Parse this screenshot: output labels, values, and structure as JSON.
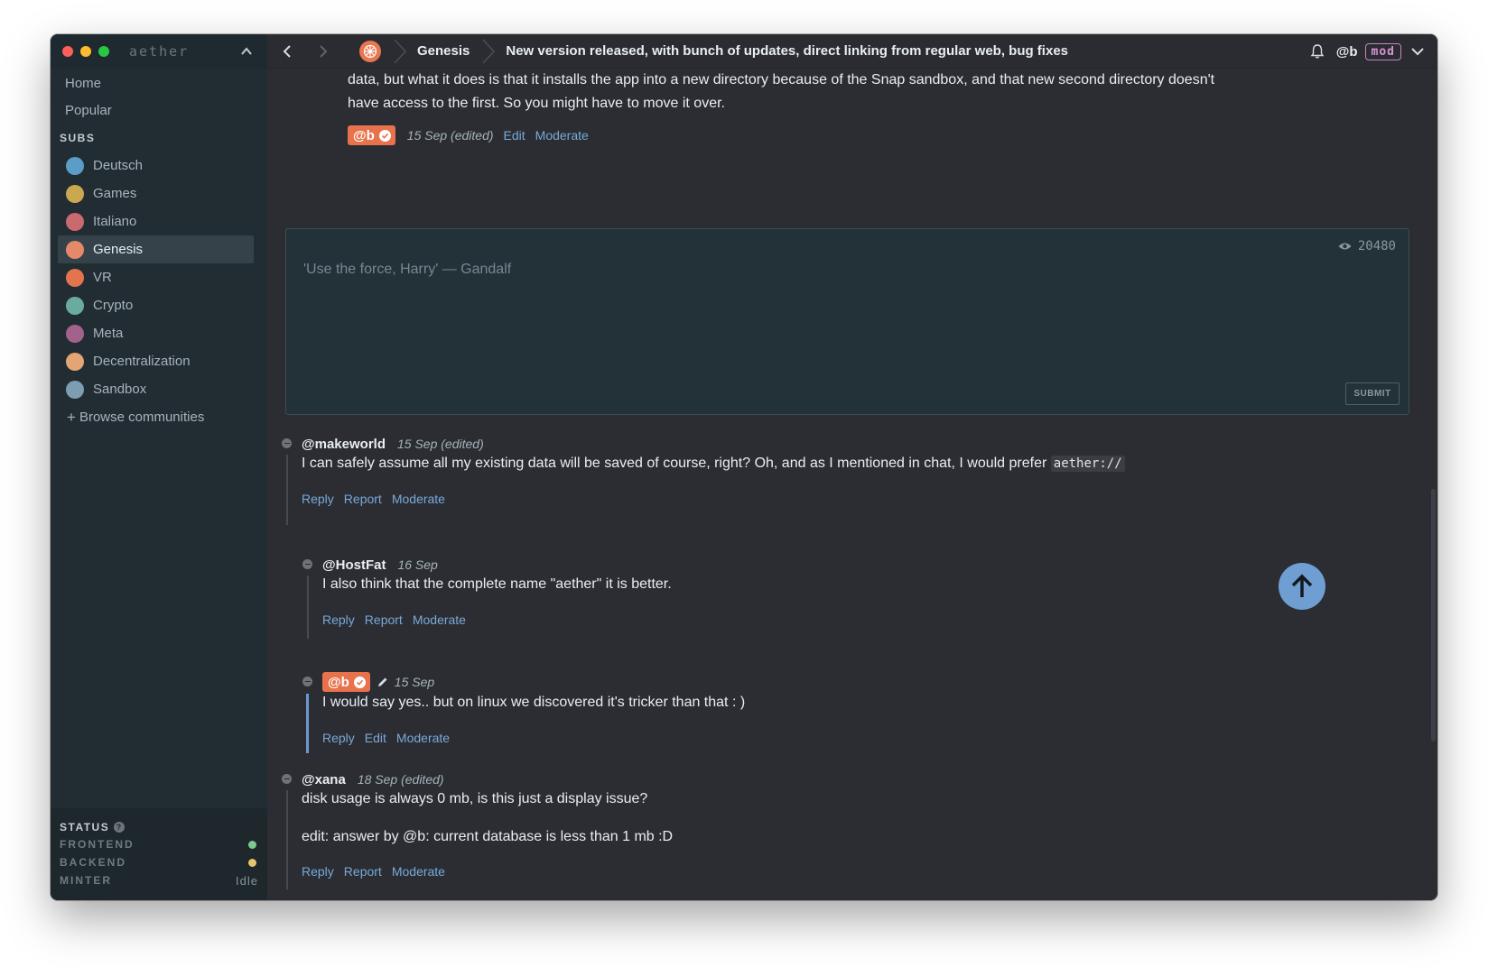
{
  "app": {
    "name": "aether"
  },
  "sidebar": {
    "nav": [
      {
        "label": "Home"
      },
      {
        "label": "Popular"
      }
    ],
    "subs_label": "SUBS",
    "subs": [
      {
        "label": "Deutsch",
        "color": "#5a9ec7",
        "active": false
      },
      {
        "label": "Games",
        "color": "#c9a84f",
        "active": false
      },
      {
        "label": "Italiano",
        "color": "#c96a6e",
        "active": false
      },
      {
        "label": "Genesis",
        "color": "#e48a6a",
        "active": true
      },
      {
        "label": "VR",
        "color": "#e3744e",
        "active": false
      },
      {
        "label": "Crypto",
        "color": "#6bab9e",
        "active": false
      },
      {
        "label": "Meta",
        "color": "#a3628c",
        "active": false
      },
      {
        "label": "Decentralization",
        "color": "#e3a574",
        "active": false
      },
      {
        "label": "Sandbox",
        "color": "#7c9db2",
        "active": false
      }
    ],
    "browse_label": "Browse communities",
    "status": {
      "title": "STATUS",
      "rows": [
        {
          "label": "FRONTEND",
          "indicator": "#7dc98f"
        },
        {
          "label": "BACKEND",
          "indicator": "#e6c46a"
        },
        {
          "label": "MINTER",
          "value": "Idle"
        }
      ]
    }
  },
  "topbar": {
    "breadcrumb_community": "Genesis",
    "breadcrumb_thread": "New version released, with bunch of updates, direct linking from regular web, bug fixes",
    "user_handle": "@b",
    "user_role": "mod"
  },
  "top_post": {
    "text": "data, but what it does is that it installs the app into a new directory because of the Snap sandbox, and that new second directory doesn't have access to the first. So you might have to move it over.",
    "author": "@b",
    "date": "15 Sep (edited)",
    "actions": [
      "Edit",
      "Moderate"
    ]
  },
  "composer": {
    "placeholder": "'Use the force, Harry' — Gandalf",
    "view_count": "20480",
    "submit_label": "SUBMIT"
  },
  "comments": [
    {
      "author": "@makeworld",
      "date": "15 Sep (edited)",
      "text": "I can safely assume all my existing data will be saved of course, right? Oh, and as I mentioned in chat, I would prefer",
      "code": "aether://",
      "actions": [
        "Reply",
        "Report",
        "Moderate"
      ]
    },
    {
      "author": "@HostFat",
      "date": "16 Sep",
      "text": "I also think that the complete name \"aether\" it is better.",
      "actions": [
        "Reply",
        "Report",
        "Moderate"
      ]
    },
    {
      "author": "@b",
      "date": "15 Sep",
      "text": "I would say yes.. but on linux we discovered it's tricker than that : )",
      "actions": [
        "Reply",
        "Edit",
        "Moderate"
      ]
    },
    {
      "author": "@xana",
      "date": "18 Sep (edited)",
      "text": "disk usage is always 0 mb, is this just a display issue?",
      "text2": "edit: answer by @b: current database is less than 1 mb :D",
      "actions": [
        "Reply",
        "Report",
        "Moderate"
      ]
    }
  ]
}
